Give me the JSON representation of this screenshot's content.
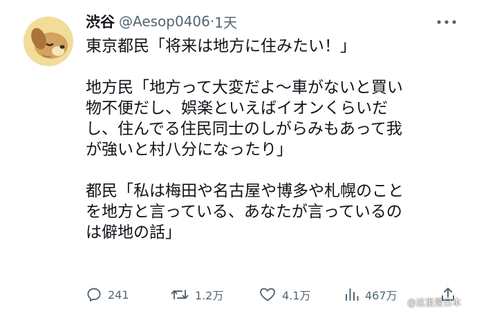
{
  "post": {
    "author_name": "渋谷",
    "handle": "@Aesop0406",
    "separator": "·",
    "time": "1天",
    "more_icon": "ellipsis-icon",
    "avatar_icon": "dog-avatar"
  },
  "body": {
    "lines": [
      "東京都民「将来は地方に住みたい！」",
      "",
      "地方民「地方って大変だよ～車がないと買い",
      "物不便だし、娯楽といえばイオンくらいだ",
      "し、住んでる住民同士のしがらみもあって我",
      "が強いと村八分になったり」",
      "",
      "都民「私は梅田や名古屋や博多や札幌のこと",
      "を地方と言っている、あなたが言っているの",
      "は僻地の話」"
    ]
  },
  "actions": {
    "reply_count": "241",
    "repost_count": "1.2万",
    "like_count": "4.1万",
    "views_count": "467万",
    "reply_icon": "reply-icon",
    "repost_icon": "repost-icon",
    "like_icon": "heart-icon",
    "views_icon": "views-icon",
    "share_icon": "share-icon"
  },
  "watermark": {
    "text": "@这里是日本"
  },
  "colors": {
    "text": "#0f1419",
    "secondary": "#536471",
    "avatar_bg": "#f2dc9a",
    "avatar_dog": "#d3a35f"
  }
}
